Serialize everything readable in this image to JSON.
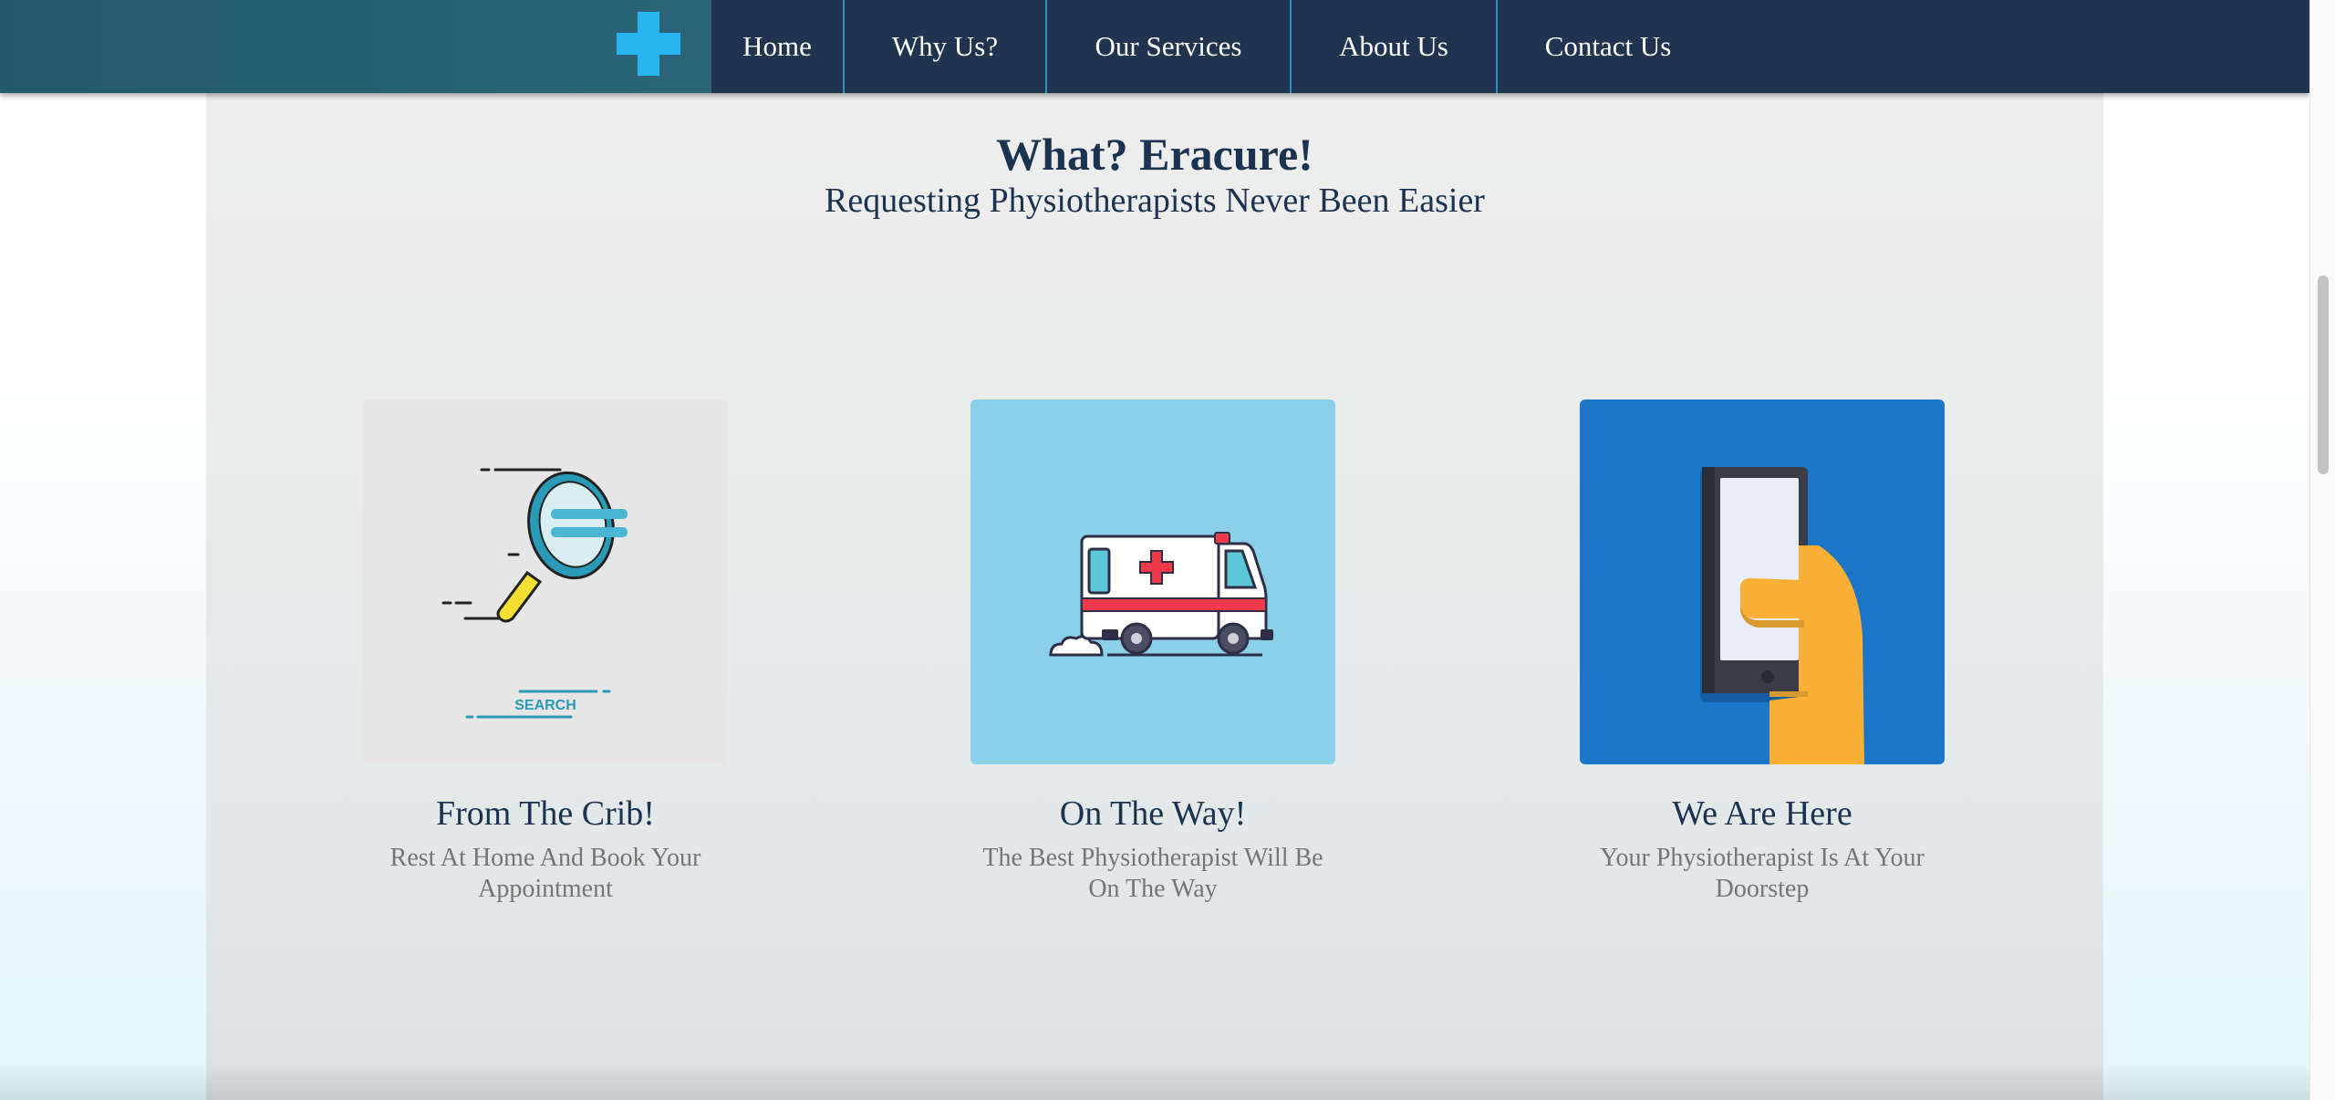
{
  "nav": {
    "logo_icon": "plus-cross-icon",
    "logo_color": "#29b6f0",
    "bar_color": "#21344f",
    "items": [
      {
        "label": "Home"
      },
      {
        "label": "Why Us?"
      },
      {
        "label": "Our Services"
      },
      {
        "label": "About Us"
      },
      {
        "label": "Contact Us"
      }
    ]
  },
  "section": {
    "title": "What? Eracure!",
    "subtitle": "Requesting Physiotherapists Never Been Easier"
  },
  "cards": [
    {
      "icon": "magnifying-glass-search-icon",
      "image_text": "SEARCH",
      "background": "#e6e6e6",
      "title": "From The Crib!",
      "description": "Rest At Home And Book Your Appointment"
    },
    {
      "icon": "ambulance-icon",
      "background": "#8bcfe9",
      "title": "On The Way!",
      "description": "The Best Physiotherapist Will Be On The Way"
    },
    {
      "icon": "hand-holding-phone-icon",
      "background": "#1b76c8",
      "title": "We Are Here",
      "description": "Your Physiotherapist Is At Your Doorstep"
    }
  ]
}
